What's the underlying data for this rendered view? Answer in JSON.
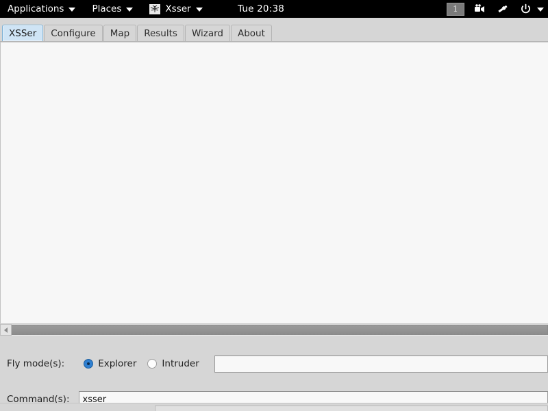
{
  "desktop_panel": {
    "menus": [
      {
        "label": "Applications",
        "icon": "",
        "caret": true
      },
      {
        "label": "Places",
        "icon": "",
        "caret": true
      },
      {
        "label": "Xsser",
        "icon": "mosquito-icon",
        "caret": true
      }
    ],
    "clock": "Tue 20:38",
    "tray": {
      "workspace": "1",
      "icons": [
        {
          "name": "video-camera-icon"
        },
        {
          "name": "network-connection-icon"
        },
        {
          "name": "power-icon"
        }
      ]
    }
  },
  "window": {
    "tabs": [
      {
        "label": "XSSer",
        "active": true
      },
      {
        "label": "Configure",
        "active": false
      },
      {
        "label": "Map",
        "active": false
      },
      {
        "label": "Results",
        "active": false
      },
      {
        "label": "Wizard",
        "active": false
      },
      {
        "label": "About",
        "active": false
      }
    ],
    "content": {
      "text": ""
    },
    "scrollbar": {
      "arrow_icon": "left-arrow-icon"
    },
    "form": {
      "fly_mode_label": "Fly mode(s):",
      "radios": [
        {
          "label": "Explorer",
          "checked": true
        },
        {
          "label": "Intruder",
          "checked": false
        }
      ],
      "fly_mode_value": "",
      "fly_mode_placeholder": "",
      "command_label": "Command(s):",
      "command_value": "xsser",
      "command_placeholder": ""
    }
  },
  "colors": {
    "panel_bg": "#000000",
    "window_chrome": "#d6d6d6",
    "content_bg": "#f7f7f7",
    "active_tab_bg": "#cfe4f5",
    "active_tab_border": "#7aafd4",
    "radio_accent": "#2f7fd0",
    "scroll_thumb": "#949494"
  }
}
